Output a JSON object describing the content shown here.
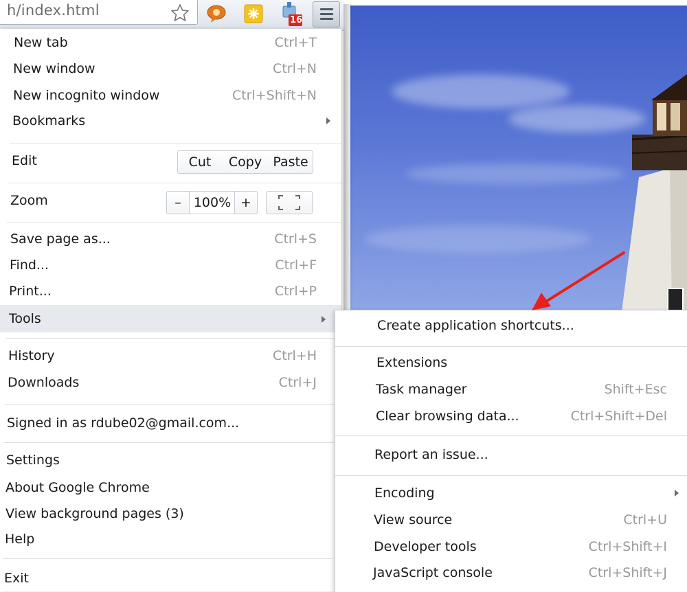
{
  "toolbar": {
    "url_fragment": "h/index.html",
    "badge_count": "16"
  },
  "menu": {
    "new_tab": {
      "label": "New tab",
      "shortcut": "Ctrl+T"
    },
    "new_window": {
      "label": "New window",
      "shortcut": "Ctrl+N"
    },
    "new_incognito": {
      "label": "New incognito window",
      "shortcut": "Ctrl+Shift+N"
    },
    "bookmarks": {
      "label": "Bookmarks"
    },
    "edit": {
      "label": "Edit",
      "cut": "Cut",
      "copy": "Copy",
      "paste": "Paste"
    },
    "zoom": {
      "label": "Zoom",
      "minus": "–",
      "value": "100%",
      "plus": "+"
    },
    "save_page": {
      "label": "Save page as...",
      "shortcut": "Ctrl+S"
    },
    "find": {
      "label": "Find...",
      "shortcut": "Ctrl+F"
    },
    "print": {
      "label": "Print...",
      "shortcut": "Ctrl+P"
    },
    "tools": {
      "label": "Tools"
    },
    "history": {
      "label": "History",
      "shortcut": "Ctrl+H"
    },
    "downloads": {
      "label": "Downloads",
      "shortcut": "Ctrl+J"
    },
    "signed_in": {
      "label": "Signed in as rdube02@gmail.com..."
    },
    "settings": {
      "label": "Settings"
    },
    "about": {
      "label": "About Google Chrome"
    },
    "background_pages": {
      "label": "View background pages (3)"
    },
    "help": {
      "label": "Help"
    },
    "exit": {
      "label": "Exit"
    }
  },
  "tools_menu": {
    "create_shortcuts": {
      "label": "Create application shortcuts..."
    },
    "extensions": {
      "label": "Extensions"
    },
    "task_manager": {
      "label": "Task manager",
      "shortcut": "Shift+Esc"
    },
    "clear_browsing": {
      "label": "Clear browsing data...",
      "shortcut": "Ctrl+Shift+Del"
    },
    "report_issue": {
      "label": "Report an issue..."
    },
    "encoding": {
      "label": "Encoding"
    },
    "view_source": {
      "label": "View source",
      "shortcut": "Ctrl+U"
    },
    "developer_tools": {
      "label": "Developer tools",
      "shortcut": "Ctrl+Shift+I"
    },
    "js_console": {
      "label": "JavaScript console",
      "shortcut": "Ctrl+Shift+J"
    }
  },
  "colors": {
    "annotation_arrow": "#e8201c",
    "highlight": "#e6e9ee",
    "shortcut_text": "#9a9a9a"
  }
}
